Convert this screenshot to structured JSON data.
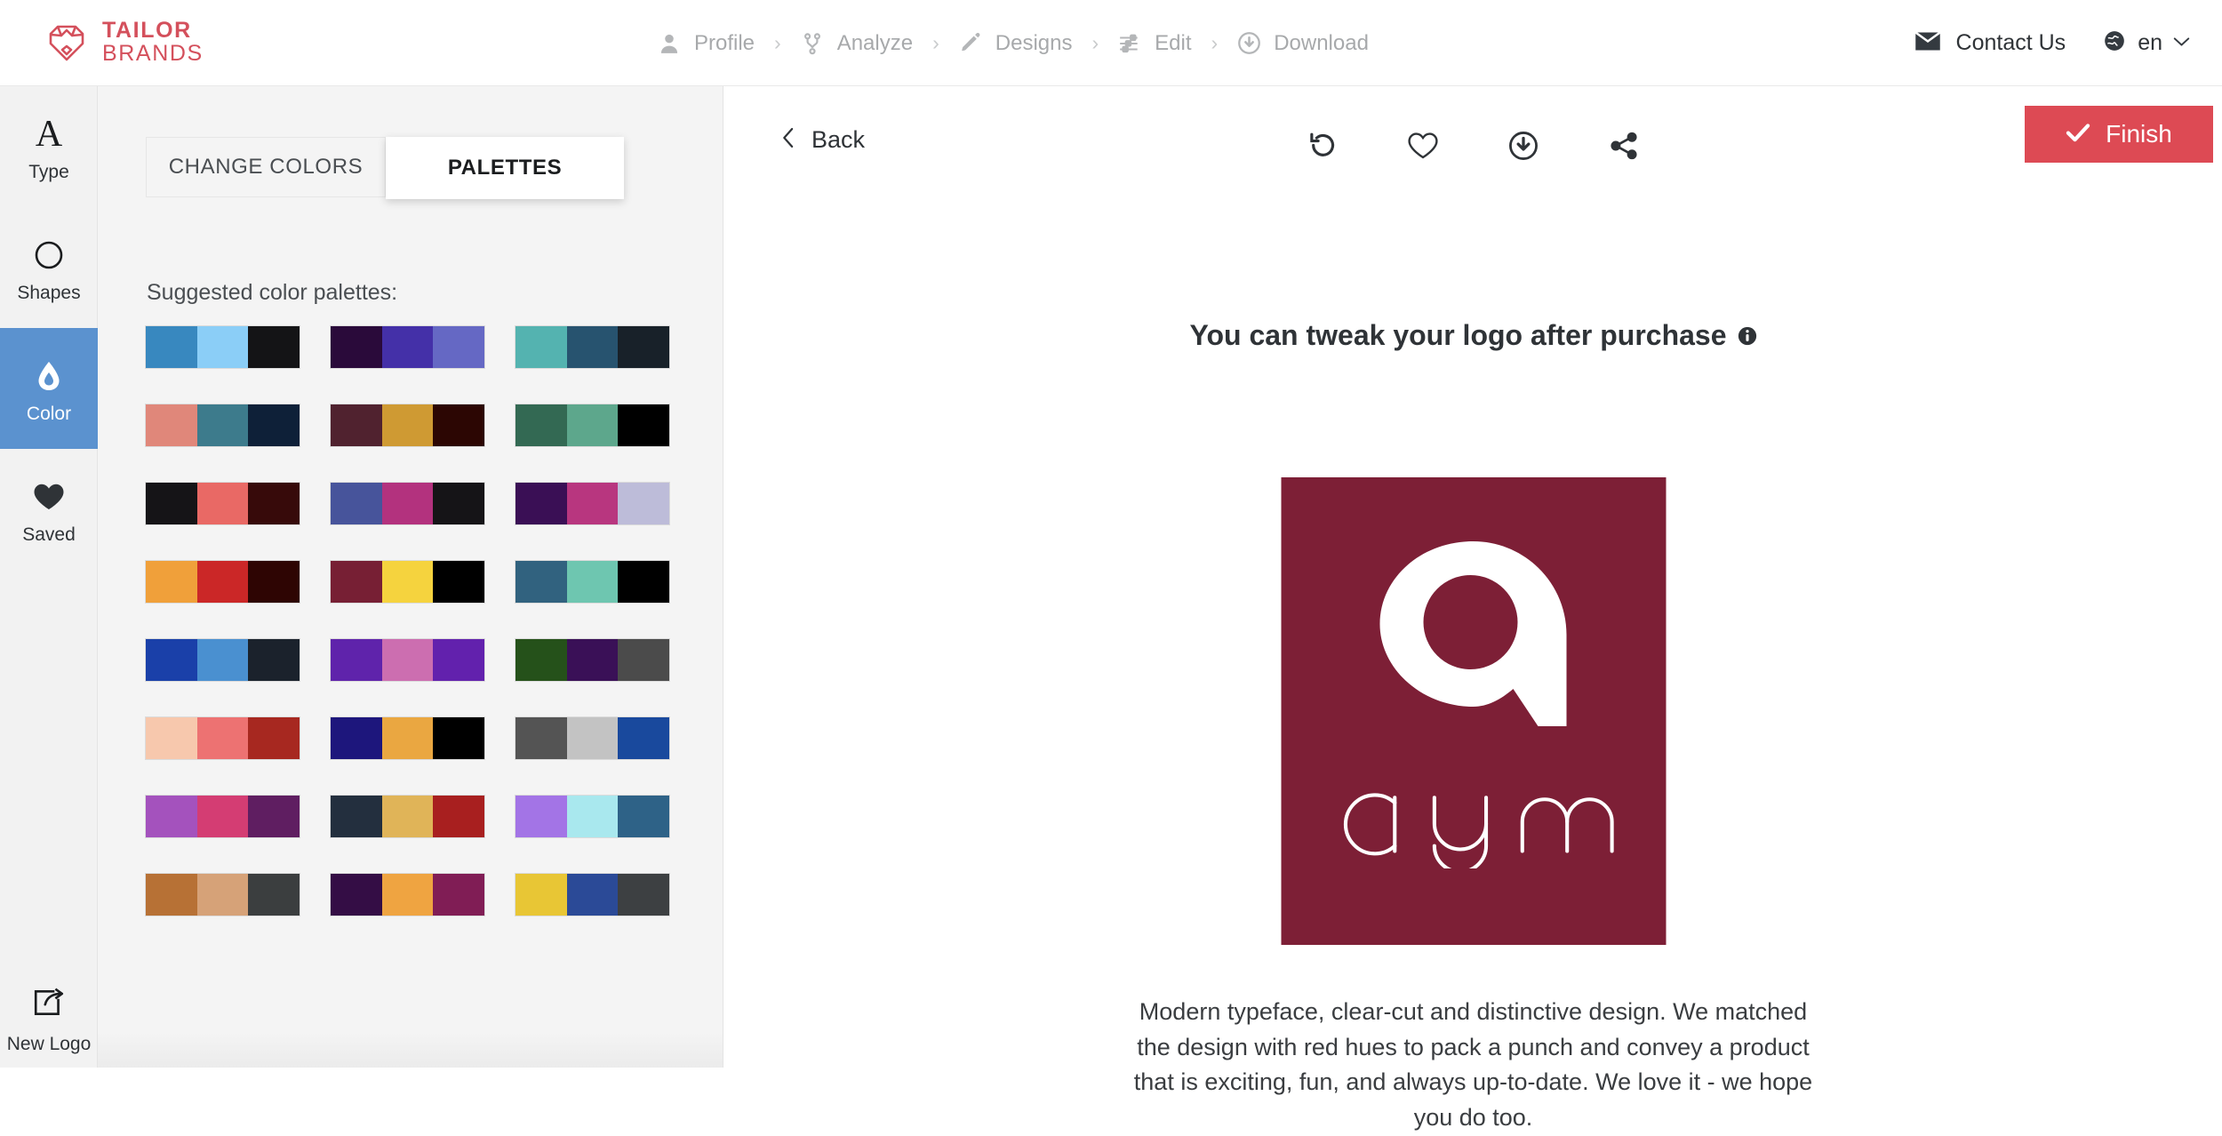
{
  "brand": {
    "line1": "TAILOR",
    "line2": "BRANDS",
    "color": "#d4505c",
    "logo_icon": "tailor-brands-shield-heart-icon"
  },
  "breadcrumb": {
    "separator": "›",
    "items": [
      {
        "label": "Profile",
        "icon": "user-icon"
      },
      {
        "label": "Analyze",
        "icon": "branch-icon"
      },
      {
        "label": "Designs",
        "icon": "pencil-icon"
      },
      {
        "label": "Edit",
        "icon": "sliders-icon"
      },
      {
        "label": "Download",
        "icon": "download-circle-icon"
      }
    ]
  },
  "top_right": {
    "contact_label": "Contact Us",
    "contact_icon": "envelope-icon",
    "language_label": "en",
    "language_icon": "globe-icon",
    "chevron_icon": "chevron-down-icon"
  },
  "sidebar": {
    "items": [
      {
        "label": "Type",
        "icon": "serif-a-icon",
        "active": false
      },
      {
        "label": "Shapes",
        "icon": "circle-icon",
        "active": false
      },
      {
        "label": "Color",
        "icon": "droplet-icon",
        "active": true
      },
      {
        "label": "Saved",
        "icon": "heart-filled-icon",
        "active": false
      }
    ],
    "active_color": "#5b92cf",
    "bottom": {
      "label": "New Logo",
      "icon": "new-logo-export-icon"
    }
  },
  "panel": {
    "tabs": [
      {
        "label": "CHANGE COLORS",
        "active": false
      },
      {
        "label": "PALETTES",
        "active": true
      }
    ],
    "subtitle": "Suggested color palettes:",
    "palettes": [
      {
        "colors": [
          "#3888bf",
          "#8bcef7",
          "#141416"
        ]
      },
      {
        "colors": [
          "#2a0a3a",
          "#4430a8",
          "#6568c4"
        ]
      },
      {
        "colors": [
          "#54b3b0",
          "#27536f",
          "#182129"
        ]
      },
      {
        "colors": [
          "#e0877a",
          "#3d7b8c",
          "#0e2038"
        ]
      },
      {
        "colors": [
          "#50222f",
          "#cf9a33",
          "#2c0603"
        ]
      },
      {
        "colors": [
          "#336953",
          "#5da78c",
          "#000000"
        ]
      },
      {
        "colors": [
          "#151417",
          "#e96965",
          "#370a0a"
        ]
      },
      {
        "colors": [
          "#47549b",
          "#b3327e",
          "#151417"
        ]
      },
      {
        "colors": [
          "#3a0f55",
          "#b8367f",
          "#bdbcd9"
        ]
      },
      {
        "colors": [
          "#f0a03a",
          "#cb2727",
          "#2e0503"
        ]
      },
      {
        "colors": [
          "#771f34",
          "#f5d33e",
          "#000000"
        ]
      },
      {
        "colors": [
          "#31627f",
          "#6ec6b0",
          "#000000"
        ]
      },
      {
        "colors": [
          "#1a40a9",
          "#4a90d0",
          "#1b222c"
        ]
      },
      {
        "colors": [
          "#5f23ab",
          "#cc6eb0",
          "#6221ad"
        ]
      },
      {
        "colors": [
          "#25511a",
          "#3a1057",
          "#4b4b4b"
        ]
      },
      {
        "colors": [
          "#f7c8ad",
          "#ed7272",
          "#a72820"
        ]
      },
      {
        "colors": [
          "#1d167c",
          "#eaa741",
          "#000000"
        ]
      },
      {
        "colors": [
          "#545454",
          "#c3c3c3",
          "#19499d"
        ]
      },
      {
        "colors": [
          "#a452bd",
          "#d43d73",
          "#5f1e61"
        ]
      },
      {
        "colors": [
          "#232f3e",
          "#e0b458",
          "#a81f1f"
        ]
      },
      {
        "colors": [
          "#a374e6",
          "#a9e8ee",
          "#2e6287"
        ]
      },
      {
        "colors": [
          "#b77135",
          "#d6a278",
          "#3b3e3f"
        ]
      },
      {
        "colors": [
          "#340d45",
          "#efa441",
          "#801d55"
        ]
      },
      {
        "colors": [
          "#e8c635",
          "#2b4a97",
          "#3d4042"
        ]
      }
    ]
  },
  "canvas": {
    "back_label": "Back",
    "back_icon": "chevron-left-icon",
    "tools": [
      {
        "name": "undo-icon",
        "label": "Undo"
      },
      {
        "name": "heart-outline-icon",
        "label": "Favorite"
      },
      {
        "name": "download-circle-icon",
        "label": "Download"
      },
      {
        "name": "share-icon",
        "label": "Share"
      }
    ],
    "finish": {
      "label": "Finish",
      "icon": "check-icon",
      "color": "#dd4a54"
    },
    "tweak_heading": "You can tweak your logo after purchase",
    "tweak_info_icon": "info-icon",
    "logo": {
      "background": "#7d1f36",
      "mark_icon": "aym-a-mark-icon",
      "wordmark": "aym",
      "foreground": "#ffffff"
    },
    "description": "Modern typeface, clear-cut and distinctive design. We matched the design with red hues to pack a punch and convey a product that is exciting, fun, and always up-to-date. We love it - we hope you do too."
  }
}
